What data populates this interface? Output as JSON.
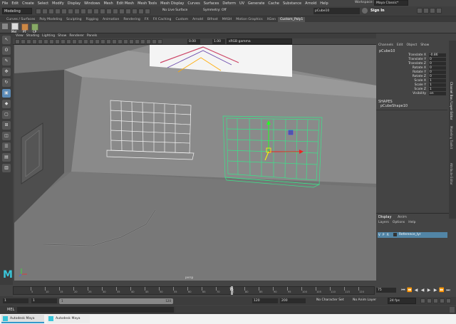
{
  "menubar": {
    "items": [
      "File",
      "Edit",
      "Create",
      "Select",
      "Modify",
      "Display",
      "Windows",
      "Mesh",
      "Edit Mesh",
      "Mesh Tools",
      "Mesh Display",
      "Curves",
      "Surfaces",
      "Deform",
      "UV",
      "Generate",
      "Cache",
      "Substance",
      "Arnold",
      "Help"
    ],
    "workspace_label": "Workspace :",
    "workspace_value": "Maya Classic*"
  },
  "statusline": {
    "mode": "Modeling",
    "live_surface": "No Live Surface",
    "symmetry": "Symmetry: Off",
    "object_field": "pCube10",
    "sign_in": "Sign In"
  },
  "shelf": {
    "tabs": [
      "Curves / Surfaces",
      "Poly Modeling",
      "Sculpting",
      "Rigging",
      "Animation",
      "Rendering",
      "FX",
      "FX Caching",
      "Custom",
      "Arnold",
      "Bifrost",
      "MASH",
      "Motion Graphics",
      "XGen",
      "Custom_Poly1"
    ],
    "active_tab": "Custom_Poly1",
    "buttons": [
      "Mel",
      "PT",
      "CP"
    ]
  },
  "viewport": {
    "menu": [
      "View",
      "Shading",
      "Lighting",
      "Show",
      "Renderer",
      "Panels"
    ],
    "exposure": "0.00",
    "gamma": "1.00",
    "colorspace": "sRGB gamma",
    "camera_label": "persp"
  },
  "channelbox": {
    "menu": [
      "Channels",
      "Edit",
      "Object",
      "Show"
    ],
    "object": "pCube10",
    "attributes": [
      {
        "name": "Translate X",
        "value": "-0.86"
      },
      {
        "name": "Translate Y",
        "value": "0"
      },
      {
        "name": "Translate Z",
        "value": "0"
      },
      {
        "name": "Rotate X",
        "value": "0"
      },
      {
        "name": "Rotate Y",
        "value": "0"
      },
      {
        "name": "Rotate Z",
        "value": "0"
      },
      {
        "name": "Scale X",
        "value": "1"
      },
      {
        "name": "Scale Y",
        "value": "1"
      },
      {
        "name": "Scale Z",
        "value": "1"
      },
      {
        "name": "Visibility",
        "value": "on"
      }
    ],
    "shapes_header": "SHAPES",
    "shape": "pCubeShape10",
    "side_tabs": [
      "Channel Box / Layer Editor",
      "Modeling Toolkit",
      "Attribute Editor"
    ]
  },
  "layers": {
    "tabs": [
      "Display",
      "Anim"
    ],
    "menu": [
      "Layers",
      "Options",
      "Help"
    ],
    "layer_name": "Reference_lyr",
    "flags": [
      "V",
      "P",
      "R"
    ]
  },
  "timeline": {
    "ticks": [
      "5",
      "10",
      "15",
      "20",
      "25",
      "30",
      "35",
      "40",
      "45",
      "50",
      "55",
      "60",
      "65",
      "70",
      "75",
      "80",
      "85",
      "90",
      "95",
      "100",
      "105",
      "110",
      "115",
      "120"
    ],
    "current_frame": "75",
    "current_frame_field": "75"
  },
  "range": {
    "start": "1",
    "start2": "1",
    "slider_start": "1",
    "slider_end": "120",
    "end": "120",
    "end2": "200",
    "character_set": "No Character Set",
    "anim_layer": "No Anim Layer",
    "fps": "24 fps"
  },
  "cmdline": {
    "label": "MEL"
  },
  "taskbar": {
    "item1": "Autodesk Maya",
    "item2": "Autodesk Maya"
  }
}
